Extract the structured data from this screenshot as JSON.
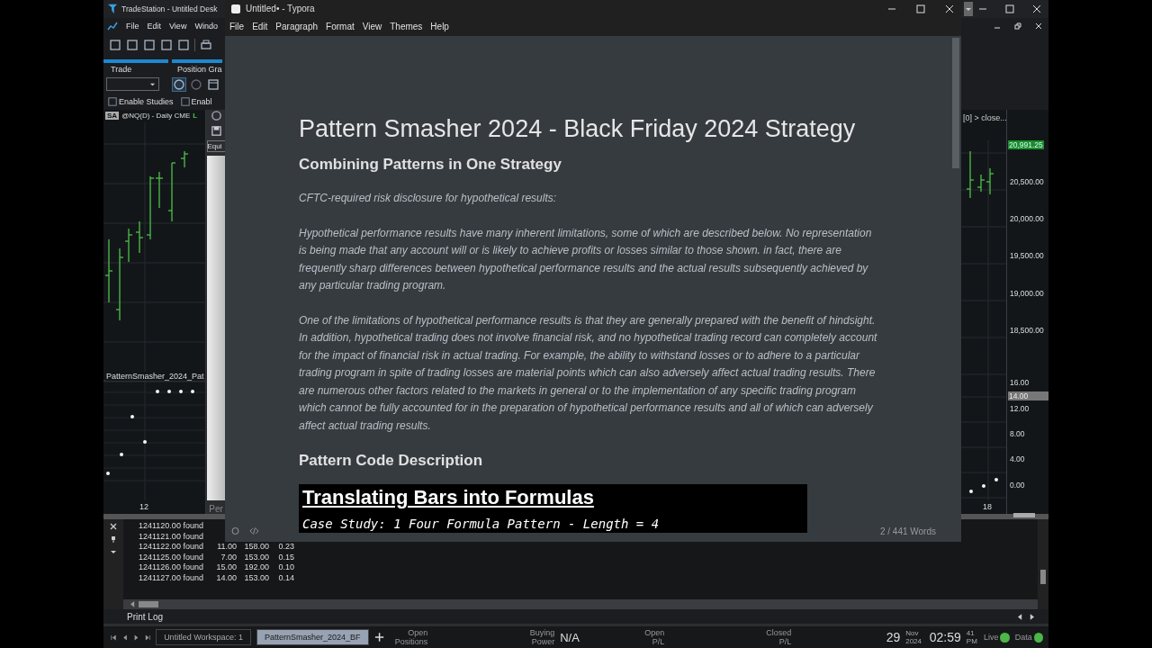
{
  "tradestation": {
    "title": "TradeStation - Untitled Desk",
    "menu": [
      "File",
      "Edit",
      "View",
      "Windo"
    ],
    "tabs": [
      "Trade",
      "Position Gra"
    ],
    "studies": [
      "Enable Studies",
      "Enabl"
    ],
    "chart_header": {
      "badge": "SA",
      "symbol": "@NQ(D) - Daily  CME",
      "feed": "L"
    },
    "study_label": "PatternSmasher_2024_Pat",
    "left_date": "12",
    "right_date": "18",
    "inner_window": {
      "field": "Equi",
      "label": "Per"
    },
    "right_header": "[0] > close...",
    "price_axis": [
      {
        "label": "20,991.25",
        "kind": "current"
      },
      {
        "label": "20,500.00",
        "kind": "tick"
      },
      {
        "label": "20,000.00",
        "kind": "tick"
      },
      {
        "label": "19,500.00",
        "kind": "tick"
      },
      {
        "label": "19,000.00",
        "kind": "tick"
      },
      {
        "label": "18,500.00",
        "kind": "tick"
      }
    ],
    "indicator_axis": [
      {
        "label": "16.00",
        "kind": "tick"
      },
      {
        "label": "14.00",
        "kind": "current"
      },
      {
        "label": "12.00",
        "kind": "tick"
      },
      {
        "label": "8.00",
        "kind": "tick"
      },
      {
        "label": "4.00",
        "kind": "tick"
      },
      {
        "label": "0.00",
        "kind": "tick"
      }
    ],
    "print_log": {
      "title": "Print Log",
      "lines": [
        [
          "1241120.00 found"
        ],
        [
          "1241121.00 found"
        ],
        [
          "1241122.00 found",
          "11.00",
          "158.00",
          "0.23"
        ],
        [
          "1241125.00 found",
          "7.00",
          "153.00",
          "0.15"
        ],
        [
          "1241126.00 found",
          "15.00",
          "192.00",
          "0.10"
        ],
        [
          "1241127.00 found",
          "14.00",
          "153.00",
          "0.14"
        ]
      ]
    },
    "workspace_tabs": [
      {
        "label": "Untitled Workspace:  1",
        "selected": false
      },
      {
        "label": "PatternSmasher_2024_BF",
        "selected": true
      }
    ],
    "status": [
      {
        "label": "Open Positions"
      },
      {
        "label": "Buying Power",
        "value": "N/A"
      },
      {
        "label": "Open P/L"
      },
      {
        "label": "Closed P/L"
      }
    ],
    "date": {
      "day": "29",
      "month": "Nov",
      "year": "2024"
    },
    "time": {
      "hm": "02:59",
      "sec": "41",
      "ampm": "PM"
    },
    "lights": [
      {
        "label": "Live",
        "color": "#4cb648"
      },
      {
        "label": "Data",
        "color": "#4cb648"
      }
    ]
  },
  "typora": {
    "title": "Untitled• - Typora",
    "menu": [
      "File",
      "Edit",
      "Paragraph",
      "Format",
      "View",
      "Themes",
      "Help"
    ],
    "blocks": [
      {
        "kind": "h1",
        "text": "Pattern Smasher 2024 - Black Friday 2024 Strategy"
      },
      {
        "kind": "h2",
        "text": "Combining Patterns in One Strategy"
      },
      {
        "kind": "p",
        "text": "CFTC-required risk disclosure for hypothetical results:"
      },
      {
        "kind": "p",
        "text": "Hypothetical performance results have many inherent limitations, some of which are described below. No representation is being made that any account will or is likely to achieve profits or losses similar to those shown. in fact, there are frequently sharp differences between hypothetical performance results and the actual results subsequently achieved by any particular trading program."
      },
      {
        "kind": "p",
        "text": "One of the limitations of hypothetical performance results is that they are generally prepared with the benefit of hindsight. In addition, hypothetical trading does not involve financial risk, and no hypothetical trading record can completely account for the impact of financial risk in actual trading. For example, the ability to withstand losses or to adhere to a particular trading program in spite of trading losses are material points which can also adversely affect actual trading results. There are numerous other factors related to the markets in general or to the implementation of any specific trading program which cannot be fully accounted for in the preparation of hypothetical performance results and all of which can adversely affect actual trading results."
      },
      {
        "kind": "h2",
        "text": "Pattern Code Description"
      },
      {
        "kind": "image",
        "heading": "Translating Bars into Formulas",
        "caption": "Case Study: 1 Four Formula Pattern - Length = 4"
      }
    ],
    "word_count": "2 / 441 Words"
  }
}
